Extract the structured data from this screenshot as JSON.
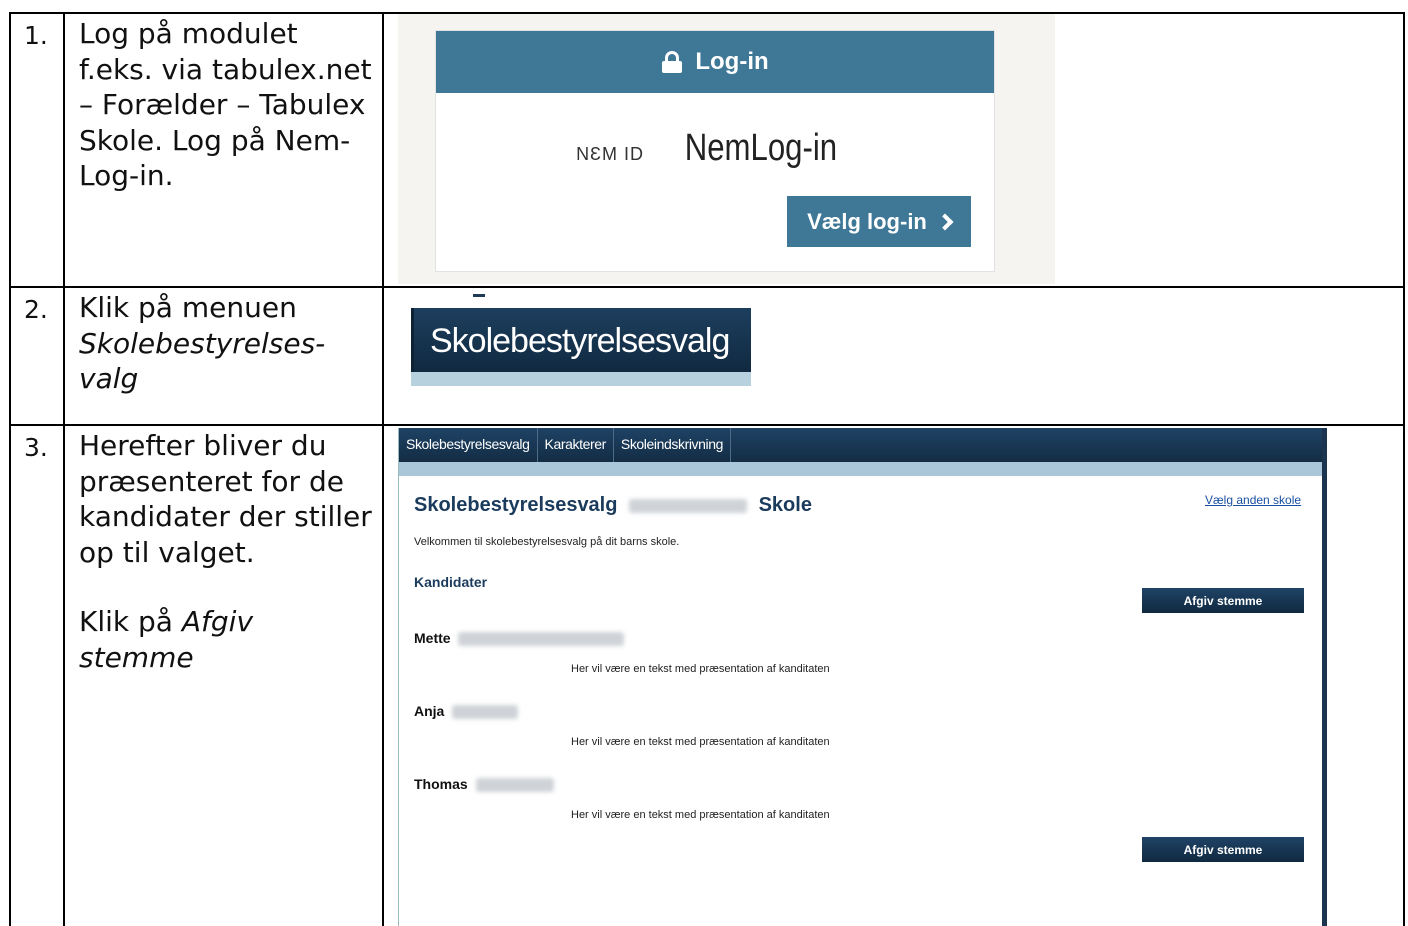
{
  "steps": [
    {
      "number": "1.",
      "text": "Log på modulet f.eks. via tabulex.net – Forælder – Tabulex Skole. Log på Nem-Log-in."
    },
    {
      "number": "2.",
      "text_prefix": "Klik på menuen ",
      "text_emphasis": "Skolebestyrelses-valg"
    },
    {
      "number": "3.",
      "text": "Herefter bliver du præsenteret for de kandidater der stiller op til valget.",
      "text2_prefix": "Klik på ",
      "text2_emphasis": "Afgiv stemme"
    }
  ],
  "login": {
    "header": "Log-in",
    "nem_id": "NƐM ID",
    "nemlogin": "NemLog-in",
    "choose_button": "Vælg log-in"
  },
  "menu": {
    "label": "Skolebestyrelsesvalg"
  },
  "vote": {
    "nav": [
      "Skolebestyrelsesvalg",
      "Karakterer",
      "Skoleindskrivning"
    ],
    "title_prefix": "Skolebestyrelsesvalg",
    "title_suffix": "Skole",
    "change_school": "Vælg anden skole",
    "welcome": "Velkommen til skolebestyrelsesvalg på dit barns skole.",
    "candidates_heading": "Kandidater",
    "vote_button": "Afgiv stemme",
    "candidates": [
      {
        "name": "Mette",
        "description": "Her vil være en tekst med præsentation af kanditaten"
      },
      {
        "name": "Anja",
        "description": "Her vil være en tekst med præsentation af kanditaten"
      },
      {
        "name": "Thomas",
        "description": "Her vil være en tekst med præsentation af kanditaten"
      }
    ]
  },
  "colors": {
    "login_blue": "#3e7896",
    "nav_dark": "#132c44",
    "subnav_light": "#a9c7d8",
    "title_blue": "#1b3b5c"
  }
}
